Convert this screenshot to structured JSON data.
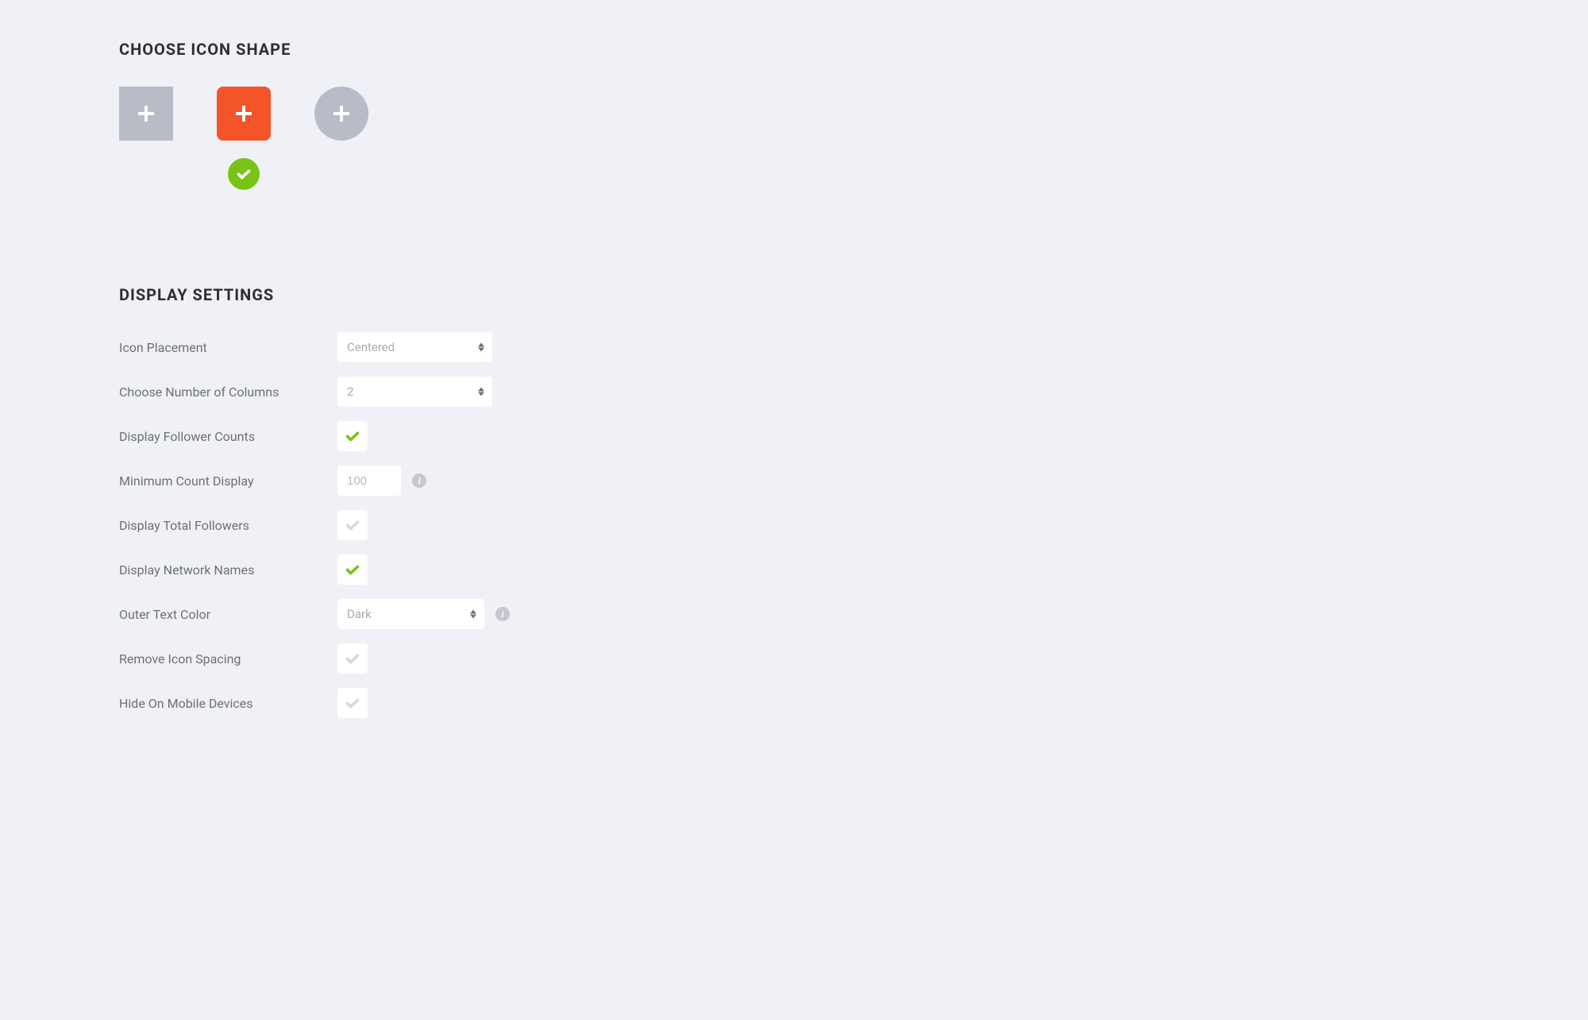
{
  "shape_section": {
    "title": "CHOOSE ICON SHAPE",
    "options": [
      "square",
      "rounded",
      "circle"
    ],
    "selected": "rounded"
  },
  "display_section": {
    "title": "DISPLAY SETTINGS",
    "rows": {
      "icon_placement": {
        "label": "Icon Placement",
        "value": "Centered"
      },
      "num_columns": {
        "label": "Choose Number of Columns",
        "value": "2"
      },
      "follower_counts": {
        "label": "Display Follower Counts",
        "checked": true
      },
      "min_count": {
        "label": "Minimum Count Display",
        "value": "100"
      },
      "total_followers": {
        "label": "Display Total Followers",
        "checked": false
      },
      "network_names": {
        "label": "Display Network Names",
        "checked": true
      },
      "outer_text_color": {
        "label": "Outer Text Color",
        "value": "Dark"
      },
      "remove_spacing": {
        "label": "Remove Icon Spacing",
        "checked": false
      },
      "hide_mobile": {
        "label": "Hide On Mobile Devices",
        "checked": false
      }
    }
  }
}
